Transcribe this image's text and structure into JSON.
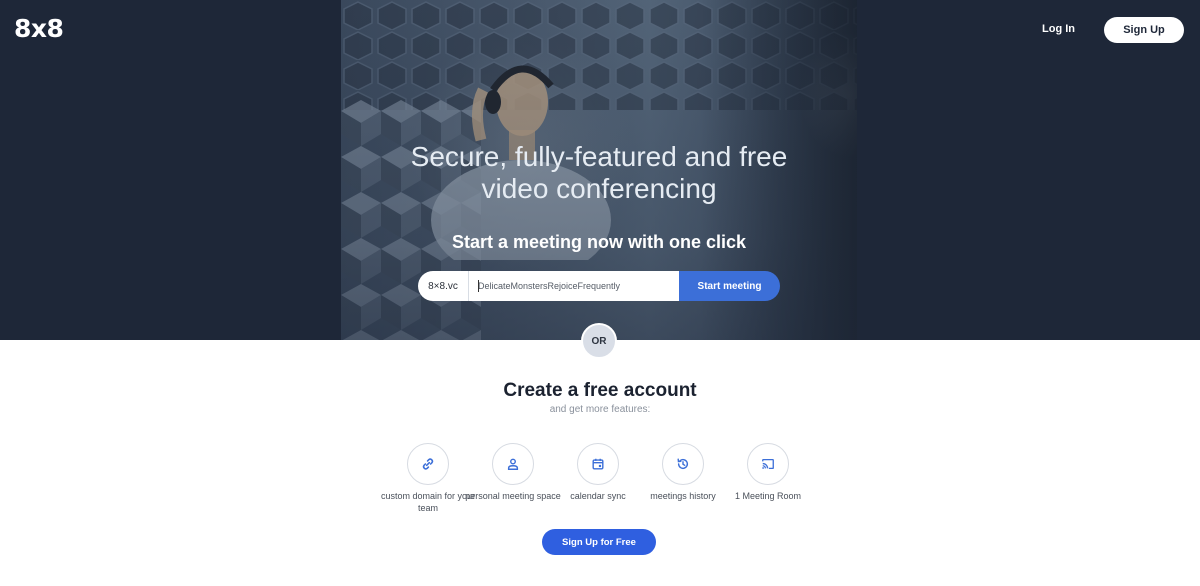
{
  "header": {
    "logo": "8x8",
    "login_label": "Log In",
    "signup_label": "Sign Up"
  },
  "hero": {
    "headline_line1": "Secure, fully-featured and free",
    "headline_line2": "video conferencing",
    "subheadline": "Start a meeting now with one click",
    "domain_prefix": "8×8.vc",
    "room_name": "DelicateMonstersRejoiceFrequently",
    "start_label": "Start meeting"
  },
  "divider": {
    "or_label": "OR"
  },
  "account": {
    "title": "Create a free account",
    "subtitle": "and get more features:",
    "features": [
      {
        "icon": "link-icon",
        "label": "custom domain for your team"
      },
      {
        "icon": "person-icon",
        "label": "personal meeting space"
      },
      {
        "icon": "calendar-icon",
        "label": "calendar sync"
      },
      {
        "icon": "history-icon",
        "label": "meetings history"
      },
      {
        "icon": "cast-icon",
        "label": "1 Meeting Room"
      }
    ],
    "cta_label": "Sign Up for Free"
  },
  "colors": {
    "hero_bg": "#1e2738",
    "accent_blue": "#3c6fd8",
    "cta_blue": "#2f5fe0",
    "or_badge": "#d9dee7"
  }
}
